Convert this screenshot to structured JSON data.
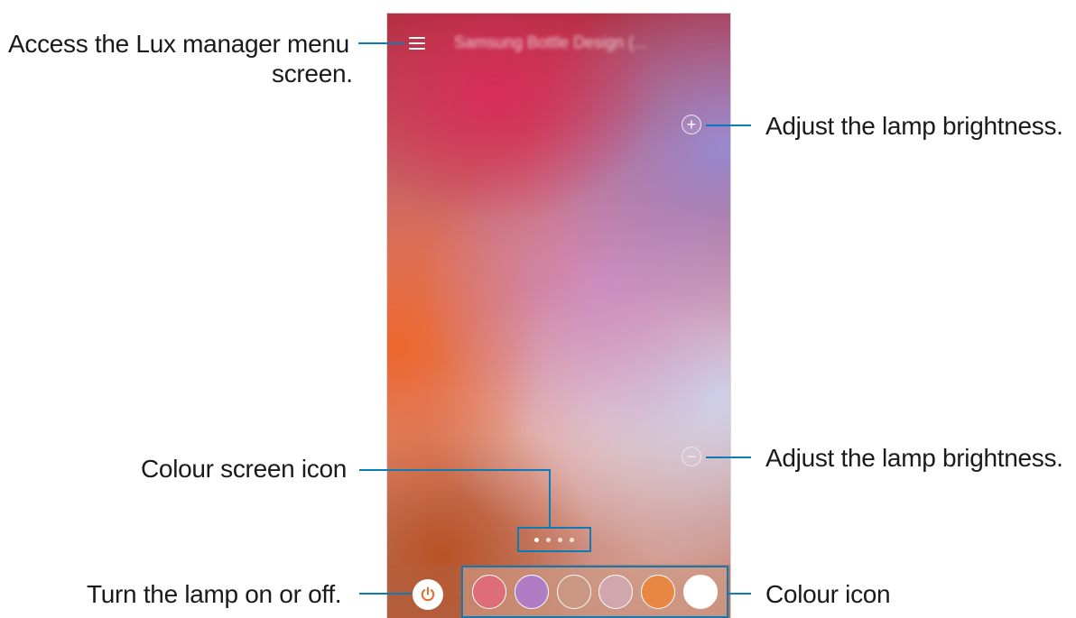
{
  "app": {
    "title": "Samsung Bottle Design (...",
    "page_indicator": {
      "count": 4,
      "active": 1
    }
  },
  "icons": {
    "menu": "hamburger-menu-icon",
    "plus": "plus-circle-icon",
    "minus": "minus-circle-icon",
    "power": "power-icon"
  },
  "swatches": [
    {
      "name": "red",
      "color": "#dd6e78"
    },
    {
      "name": "purple",
      "color": "#b07cc4"
    },
    {
      "name": "tan",
      "color": "#c99782"
    },
    {
      "name": "pink",
      "color": "#d2a6ad"
    },
    {
      "name": "orange",
      "color": "#e88743"
    },
    {
      "name": "white",
      "color": "#ffffff"
    }
  ],
  "callouts": {
    "menu_line1": "Access the Lux manager menu",
    "menu_line2": "screen.",
    "brightness_up": "Adjust the lamp brightness.",
    "brightness_down": "Adjust the lamp brightness.",
    "colour_screen": "Colour screen icon",
    "power": "Turn the lamp on or off.",
    "colour_icon": "Colour icon"
  },
  "colors": {
    "accent": "#0d7bb5",
    "power_icon": "#d9773a"
  }
}
